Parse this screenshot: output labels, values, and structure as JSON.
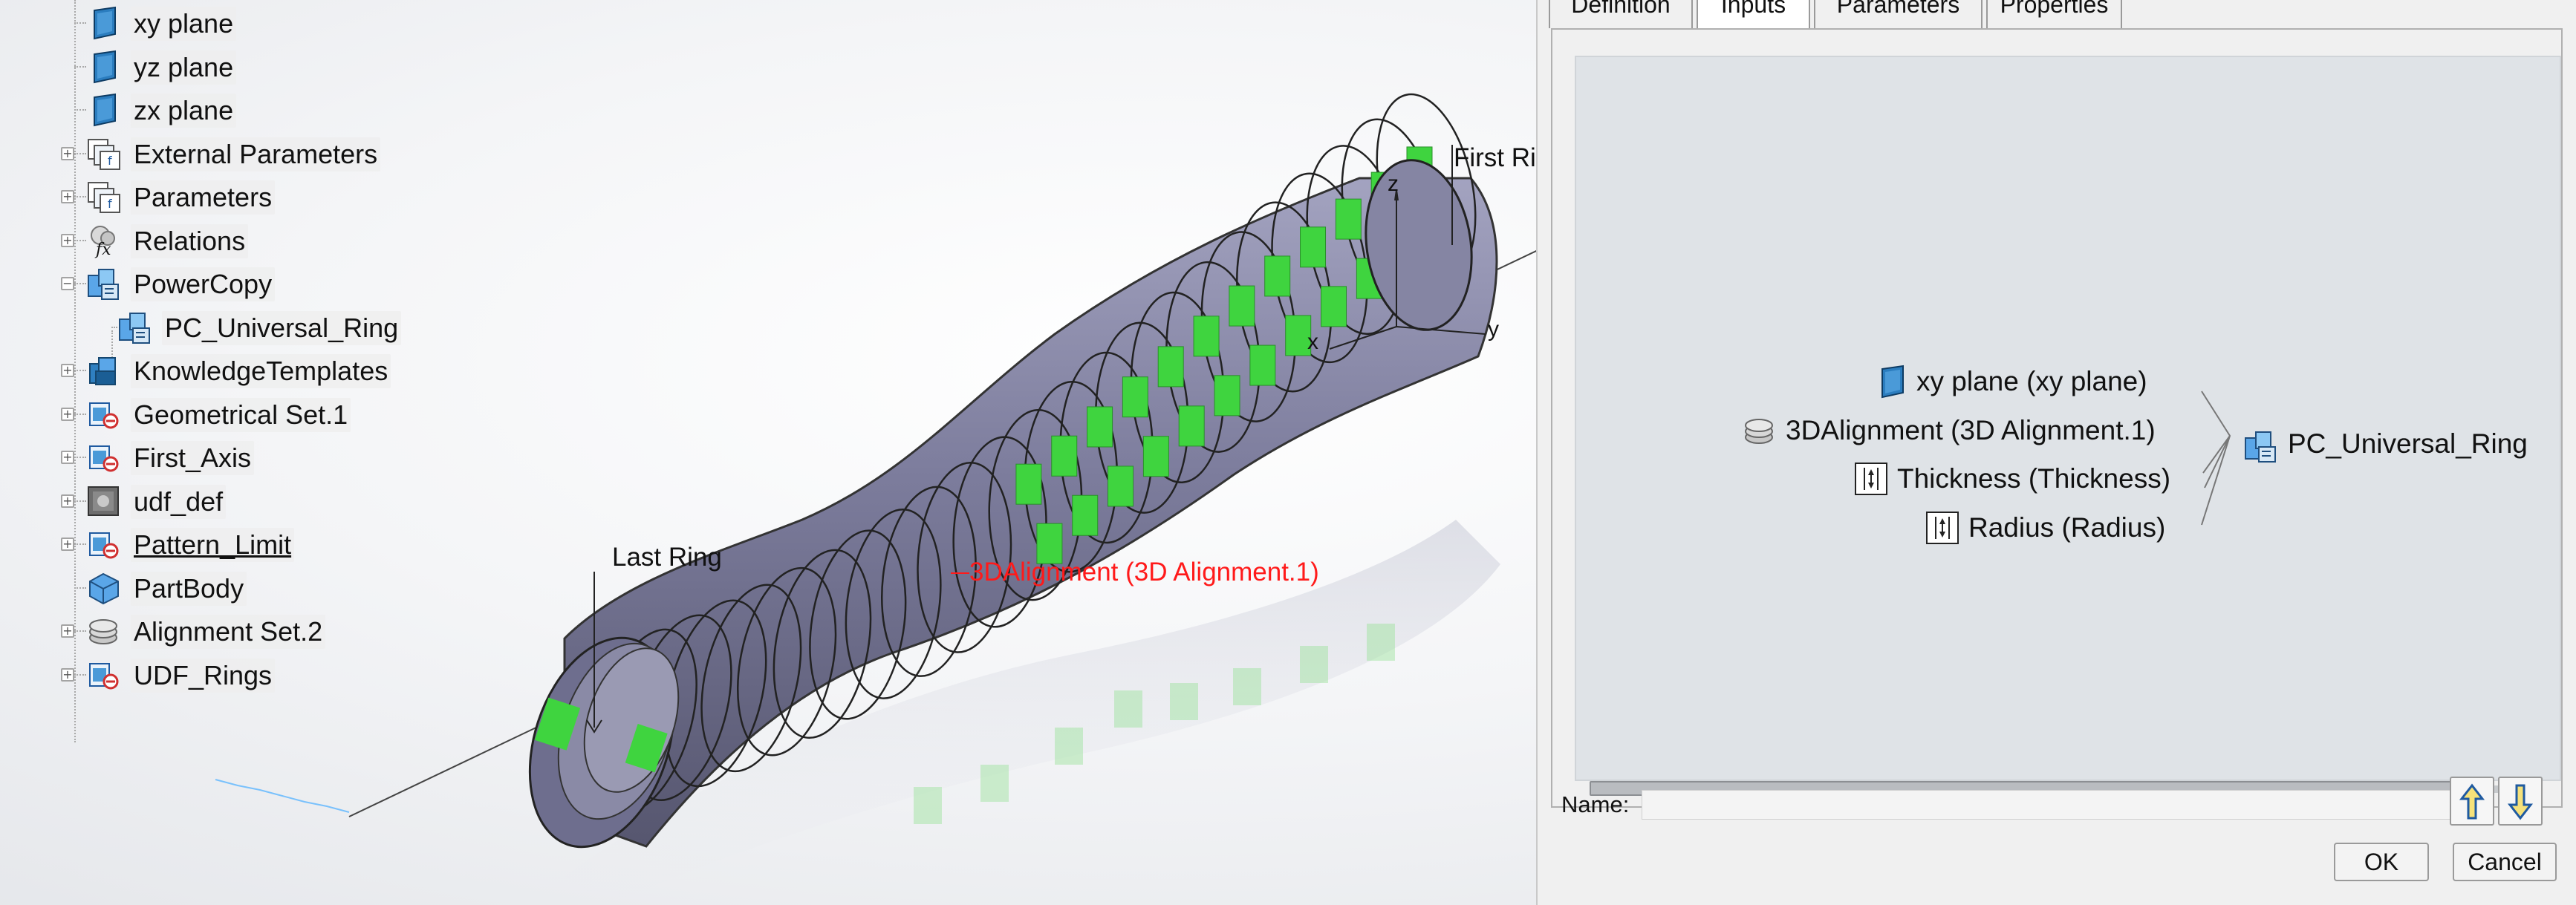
{
  "tree": {
    "items": [
      {
        "label": "xy plane",
        "icon": "plane-icon",
        "expander": ""
      },
      {
        "label": "yz plane",
        "icon": "plane-icon",
        "expander": ""
      },
      {
        "label": "zx plane",
        "icon": "plane-icon",
        "expander": ""
      },
      {
        "label": "External Parameters",
        "icon": "parameters-icon",
        "expander": "+"
      },
      {
        "label": "Parameters",
        "icon": "parameters-icon",
        "expander": "+"
      },
      {
        "label": "Relations",
        "icon": "relations-icon",
        "expander": "+"
      },
      {
        "label": "PowerCopy",
        "icon": "powercopy-icon",
        "expander": "−"
      },
      {
        "label": "PC_Universal_Ring",
        "icon": "powercopy-icon",
        "expander": ""
      },
      {
        "label": "KnowledgeTemplates",
        "icon": "knowledge-templates-icon",
        "expander": "+"
      },
      {
        "label": "Geometrical Set.1",
        "icon": "geometrical-set-icon",
        "expander": "+"
      },
      {
        "label": "First_Axis",
        "icon": "geometrical-set-icon",
        "expander": "+"
      },
      {
        "label": "udf_def",
        "icon": "udf-icon",
        "expander": "+"
      },
      {
        "label": "Pattern_Limit",
        "icon": "geometrical-set-icon",
        "expander": "+"
      },
      {
        "label": "PartBody",
        "icon": "partbody-icon",
        "expander": ""
      },
      {
        "label": "Alignment Set.2",
        "icon": "alignment-set-icon",
        "expander": "+"
      },
      {
        "label": "UDF_Rings",
        "icon": "geometrical-set-icon",
        "expander": "+"
      }
    ]
  },
  "viewport": {
    "annotation_last_ring": "Last Ring",
    "annotation_first_ring": "First Ri",
    "annotation_alignment": "3DAlignment (3D Alignment.1)",
    "axis_x": "x",
    "axis_y": "y",
    "axis_z": "z",
    "alignment_color": "#ff1a1a",
    "tube_color": "#7c7c9c",
    "band_color": "#3fd43f"
  },
  "dialog": {
    "tabs": [
      "Definition",
      "Inputs",
      "Parameters",
      "Properties"
    ],
    "active_tab": "Inputs",
    "inputs": [
      {
        "label": "xy plane (xy plane)",
        "icon": "plane-icon"
      },
      {
        "label": "3DAlignment (3D Alignment.1)",
        "icon": "alignment-set-icon"
      },
      {
        "label": "Thickness (Thickness)",
        "icon": "parameter-length-icon"
      },
      {
        "label": "Radius (Radius)",
        "icon": "parameter-length-icon"
      }
    ],
    "target": "PC_Universal_Ring",
    "name_label": "Name:",
    "name_value": "",
    "ok_label": "OK",
    "cancel_label": "Cancel"
  }
}
